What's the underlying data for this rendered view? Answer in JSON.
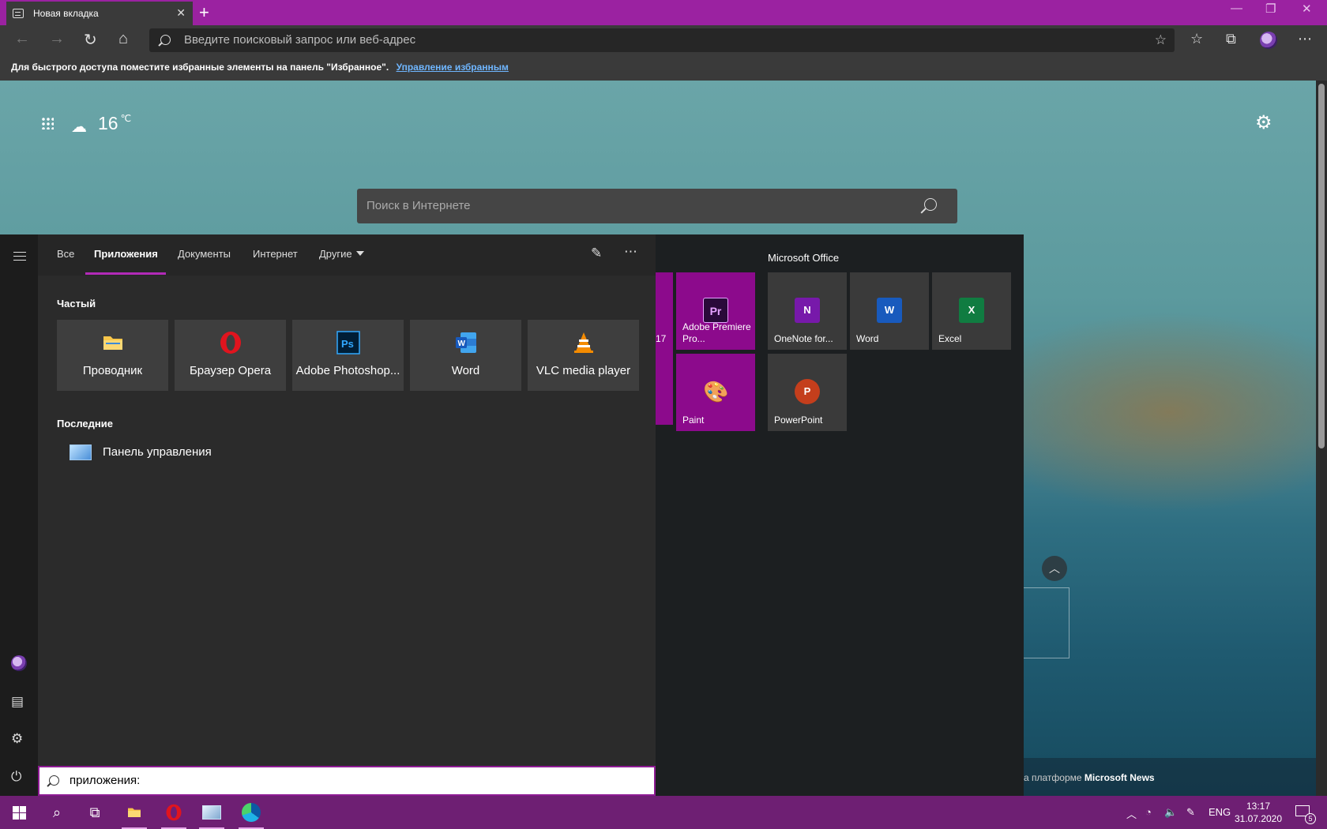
{
  "browser": {
    "tab_title": "Новая вкладка",
    "address_placeholder": "Введите поисковый запрос или веб-адрес",
    "favbar_text": "Для быстрого доступа поместите избранные элементы на панель \"Избранное\".",
    "favbar_link": "Управление избранным"
  },
  "ntp": {
    "temperature": "16",
    "temp_unit": "℃",
    "search_placeholder": "Поиск в Интернете",
    "news_prefix": "а платформе",
    "news_brand": "Microsoft News"
  },
  "search": {
    "tabs": [
      "Все",
      "Приложения",
      "Документы",
      "Интернет",
      "Другие"
    ],
    "active_tab": "Приложения",
    "frequent_heading": "Частый",
    "recent_heading": "Последние",
    "frequent_apps": [
      {
        "label": "Проводник",
        "icon": "folder-icon"
      },
      {
        "label": "Браузер Opera",
        "icon": "opera-icon"
      },
      {
        "label": "Adobe Photoshop...",
        "icon": "photoshop-icon"
      },
      {
        "label": "Word",
        "icon": "word-icon"
      },
      {
        "label": "VLC media player",
        "icon": "vlc-icon"
      }
    ],
    "recent_items": [
      {
        "label": "Панель управления",
        "icon": "control-panel-icon"
      }
    ],
    "query": "приложения:"
  },
  "tiles": {
    "group_title": "Microsoft Office",
    "partial_label": "17",
    "items": [
      {
        "label": "Adobe Premiere Pro...",
        "icon": "premiere-icon",
        "glyph": "Pr"
      },
      {
        "label": "Paint",
        "icon": "paint-icon",
        "glyph": "🎨"
      },
      {
        "label": "OneNote for...",
        "icon": "onenote-icon",
        "glyph": "N"
      },
      {
        "label": "Word",
        "icon": "word-icon",
        "glyph": "W"
      },
      {
        "label": "Excel",
        "icon": "excel-icon",
        "glyph": "X"
      },
      {
        "label": "PowerPoint",
        "icon": "powerpoint-icon",
        "glyph": "P"
      }
    ]
  },
  "taskbar": {
    "language": "ENG",
    "time": "13:17",
    "date": "31.07.2020",
    "notifications": "5"
  },
  "colors": {
    "accent": "#9b22a1",
    "taskbar": "#6e1f73",
    "tile": "#8c0a8c"
  }
}
